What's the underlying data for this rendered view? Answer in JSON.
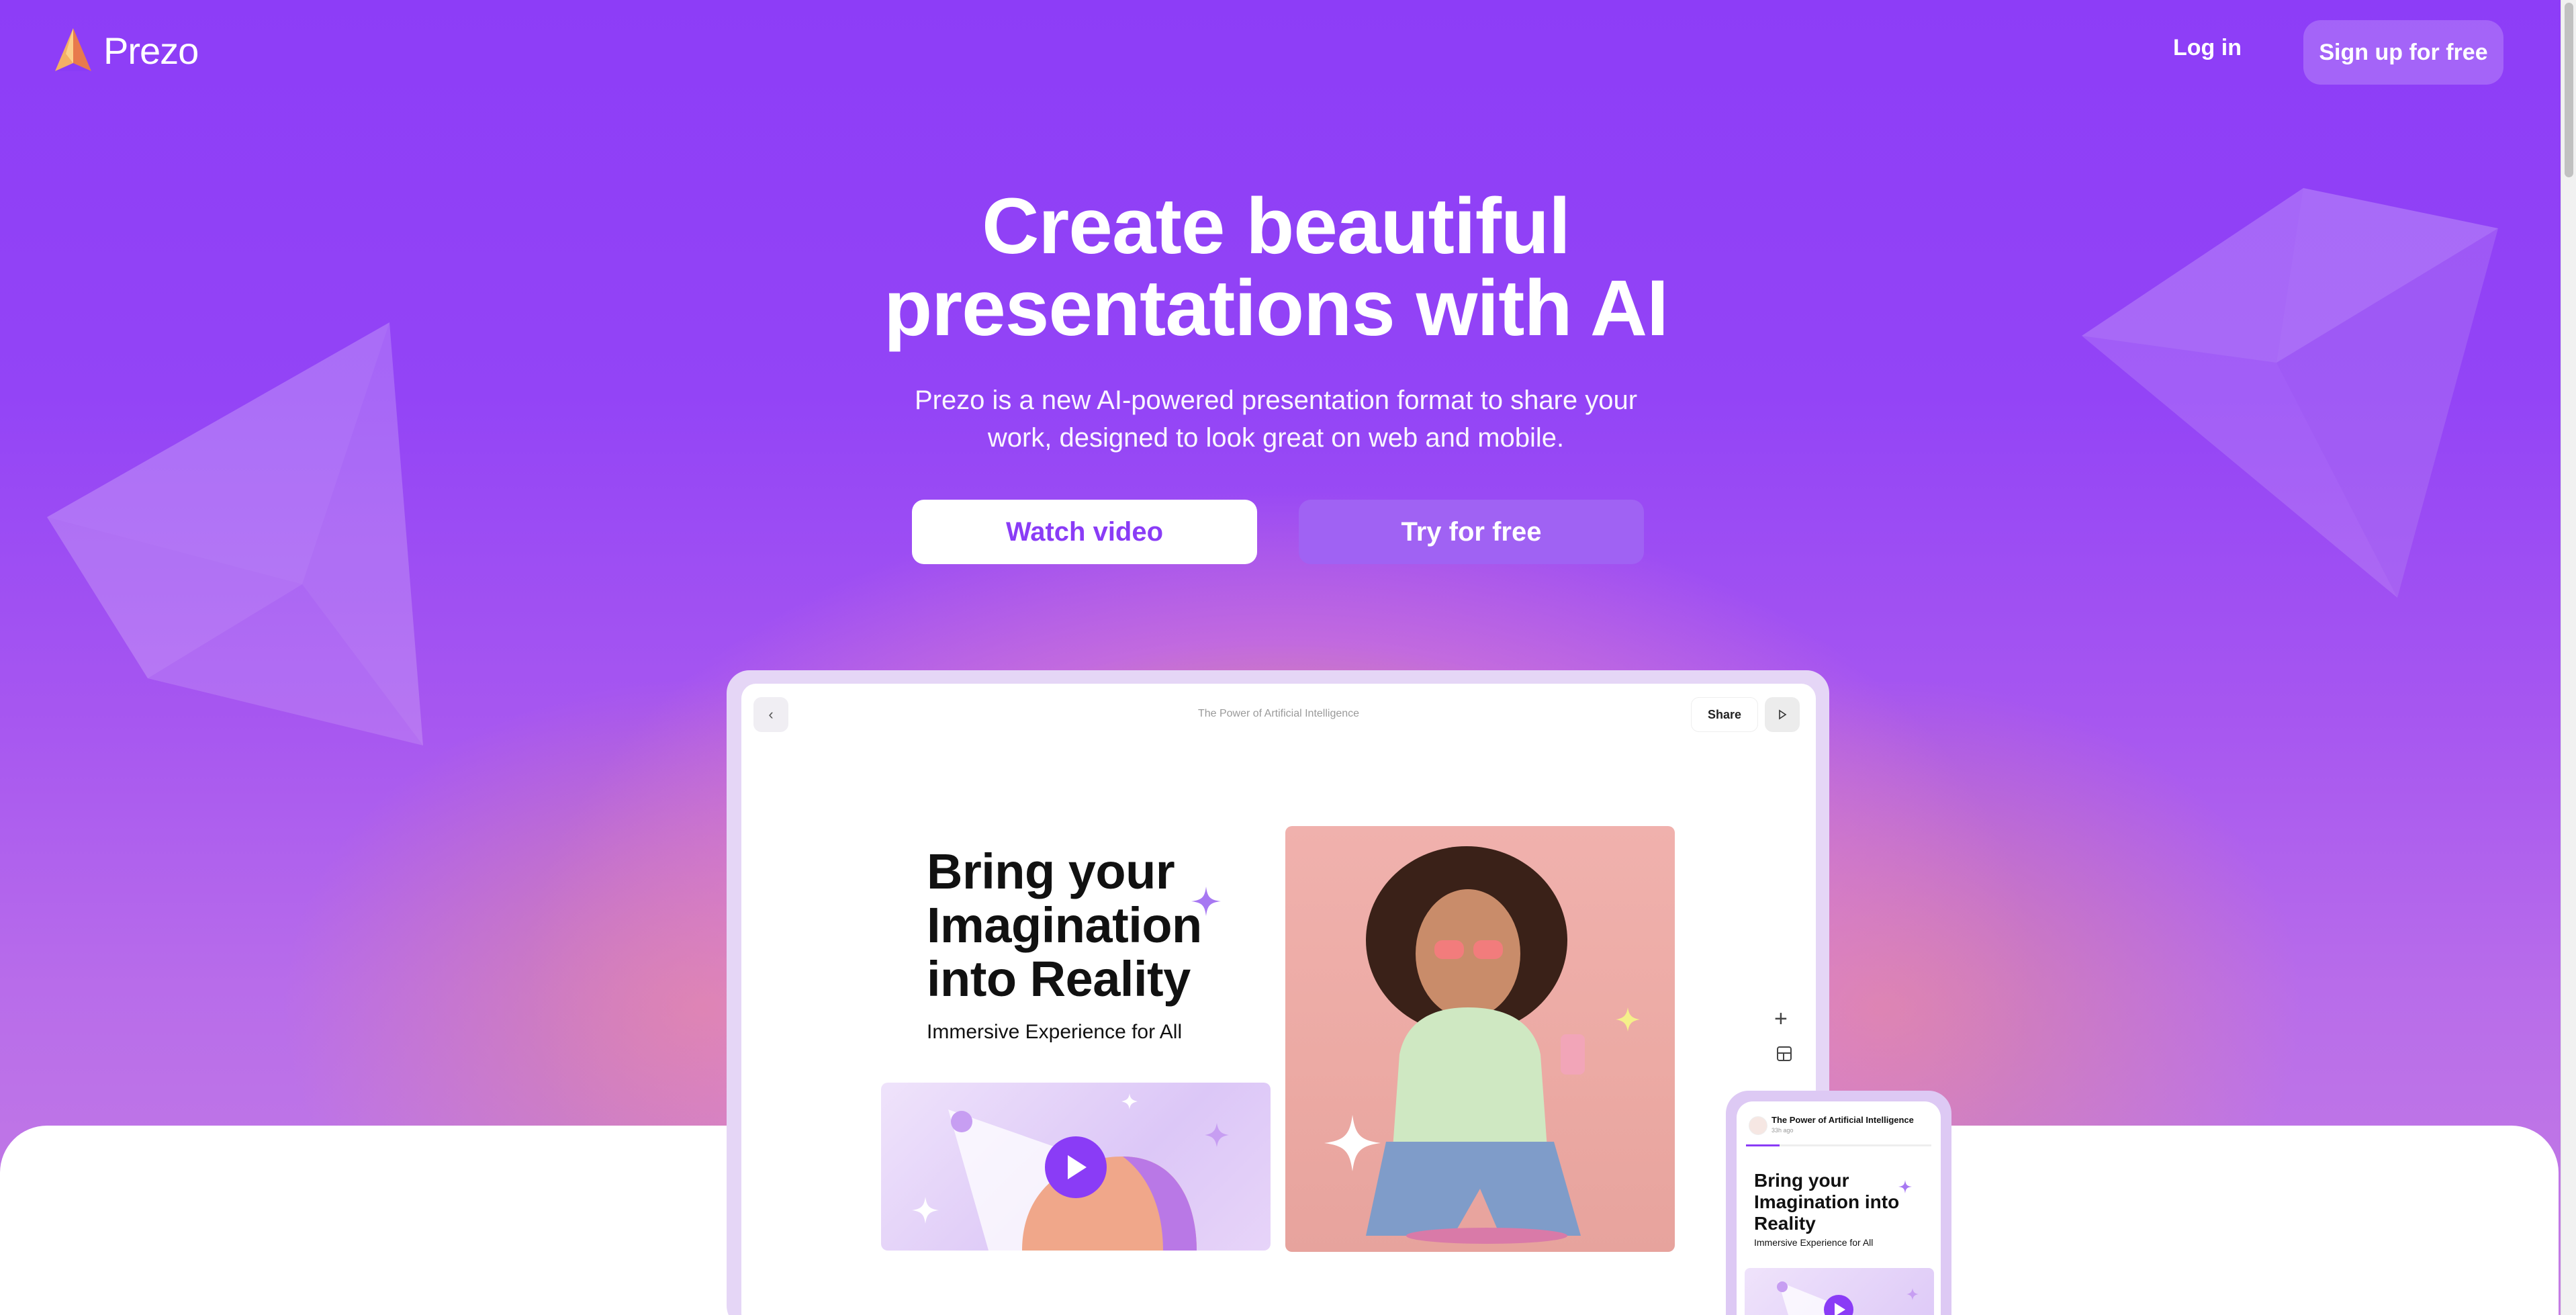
{
  "brand": {
    "name": "Prezo"
  },
  "nav": {
    "login": "Log in",
    "signup": "Sign up for free"
  },
  "hero": {
    "headline_line1": "Create beautiful",
    "headline_line2": "presentations with AI",
    "subline_line1": "Prezo is a new AI-powered presentation format to share your",
    "subline_line2": "work, designed to look great on web and mobile.",
    "watch_button": "Watch video",
    "try_button": "Try for free"
  },
  "desktop_preview": {
    "doc_title": "The Power of Artificial Intelligence",
    "share_button": "Share",
    "slide_title_line1": "Bring your",
    "slide_title_line2": "Imagination",
    "slide_title_line3": "into Reality",
    "slide_subtitle": "Immersive Experience for All"
  },
  "mobile_preview": {
    "doc_title": "The Power of Artificial Intelligence",
    "time_ago": "33h ago",
    "slide_title_line1": "Bring your",
    "slide_title_line2": "Imagination into",
    "slide_title_line3": "Reality",
    "slide_subtitle": "Immersive Experience for All",
    "progress": 0.18
  },
  "colors": {
    "brand_purple": "#8a3cf6",
    "button_purple": "#a062f3",
    "accent_orange": "#f4a96a"
  },
  "icons": [
    "prezo-logo-icon",
    "chevron-left-icon",
    "play-icon",
    "plus-icon",
    "layout-icon",
    "sparkle-icon"
  ]
}
